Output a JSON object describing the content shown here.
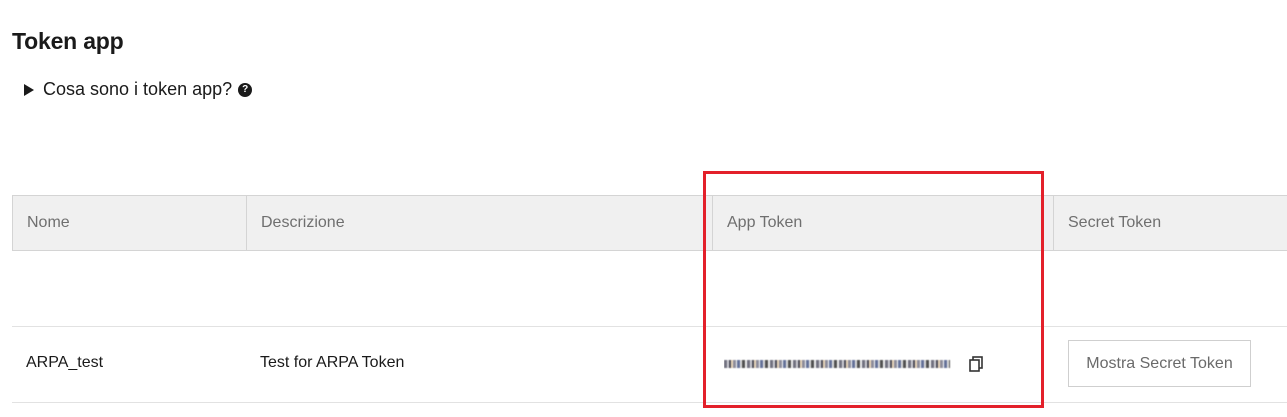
{
  "page": {
    "title": "Token app"
  },
  "faq": {
    "label": "Cosa sono i token app?",
    "help_symbol": "?"
  },
  "table": {
    "columns": [
      "Nome",
      "Descrizione",
      "App Token",
      "Secret Token"
    ],
    "rows": [
      {
        "nome": "ARPA_test",
        "descrizione": "Test for ARPA Token",
        "app_token": "(obscured)",
        "secret_button_label": "Mostra Secret Token"
      }
    ]
  },
  "colors": {
    "highlight": "#e3202a",
    "header_bg": "#f0f0f0"
  },
  "icons": {
    "faq_toggle": "triangle-right-icon",
    "help": "question-circle-icon",
    "copy": "copy-icon"
  }
}
